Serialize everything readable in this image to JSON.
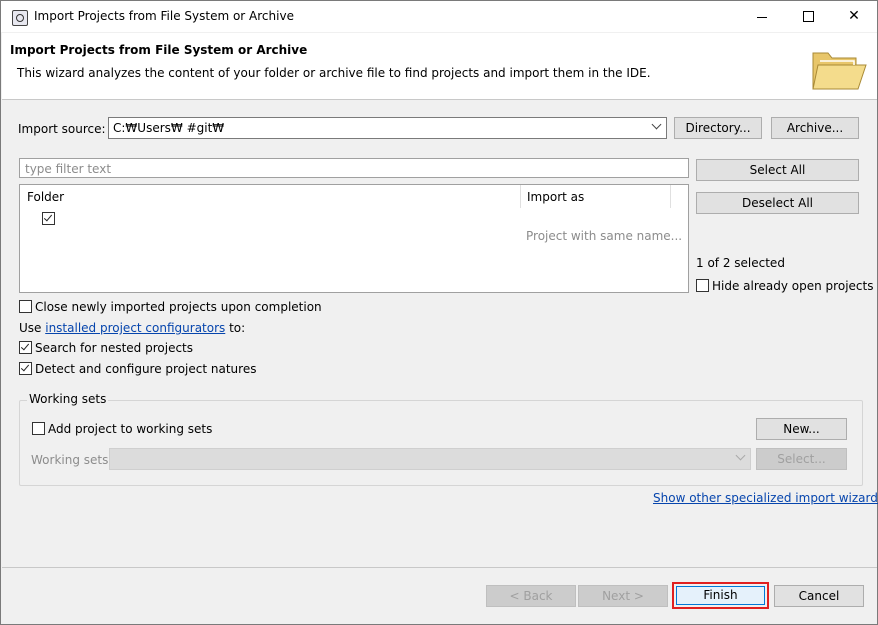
{
  "window": {
    "title": "Import Projects from File System or Archive"
  },
  "banner": {
    "title": "Import Projects from File System or Archive",
    "description": "This wizard analyzes the content of your folder or archive file to find projects and import them in the IDE."
  },
  "import_source": {
    "label": "Import source:",
    "value": "C:₩Users₩            #git₩",
    "directory_button": "Directory...",
    "archive_button": "Archive..."
  },
  "filter": {
    "placeholder": "type filter text"
  },
  "table": {
    "columns": [
      "Folder",
      "Import as"
    ],
    "rows": [
      {
        "checked": true,
        "folder": "",
        "import_as": "Project with same name..."
      }
    ]
  },
  "side": {
    "select_all": "Select All",
    "deselect_all": "Deselect All",
    "selected_count": "1 of 2 selected",
    "hide_open": "Hide already open projects"
  },
  "options": {
    "close_projects": "Close newly imported projects upon completion",
    "use_prefix": "Use ",
    "configurators_link": "installed project configurators",
    "use_suffix": " to:",
    "search_nested": "Search for nested projects",
    "detect_natures": "Detect and configure project natures"
  },
  "working_sets": {
    "title": "Working sets",
    "add_label": "Add project to working sets",
    "new_button": "New...",
    "sets_label": "Working sets:",
    "select_button": "Select..."
  },
  "footer": {
    "specialized_link": "Show other specialized import wizards",
    "back": "< Back",
    "next": "Next >",
    "finish": "Finish",
    "cancel": "Cancel"
  },
  "colors": {
    "link": "#0645ad",
    "highlight": "#e02020"
  }
}
